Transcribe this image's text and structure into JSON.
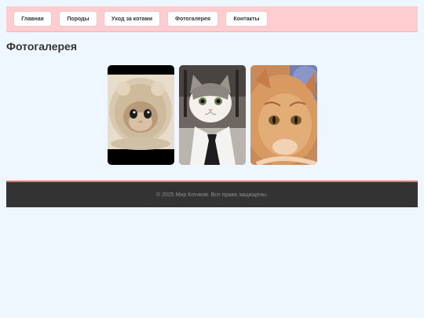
{
  "nav": {
    "items": [
      {
        "label": "Главная"
      },
      {
        "label": "Породы"
      },
      {
        "label": "Уход за котами"
      },
      {
        "label": "Фотогалерея"
      },
      {
        "label": "Контакты"
      }
    ]
  },
  "main": {
    "title": "Фотогалерея"
  },
  "footer": {
    "text": "© 2025 Мир Котиков. Все права защищены."
  },
  "colors": {
    "nav_background": "#ffcdd0",
    "page_background": "#eef6ff",
    "footer_background": "#333333",
    "footer_accent": "#e57373"
  }
}
